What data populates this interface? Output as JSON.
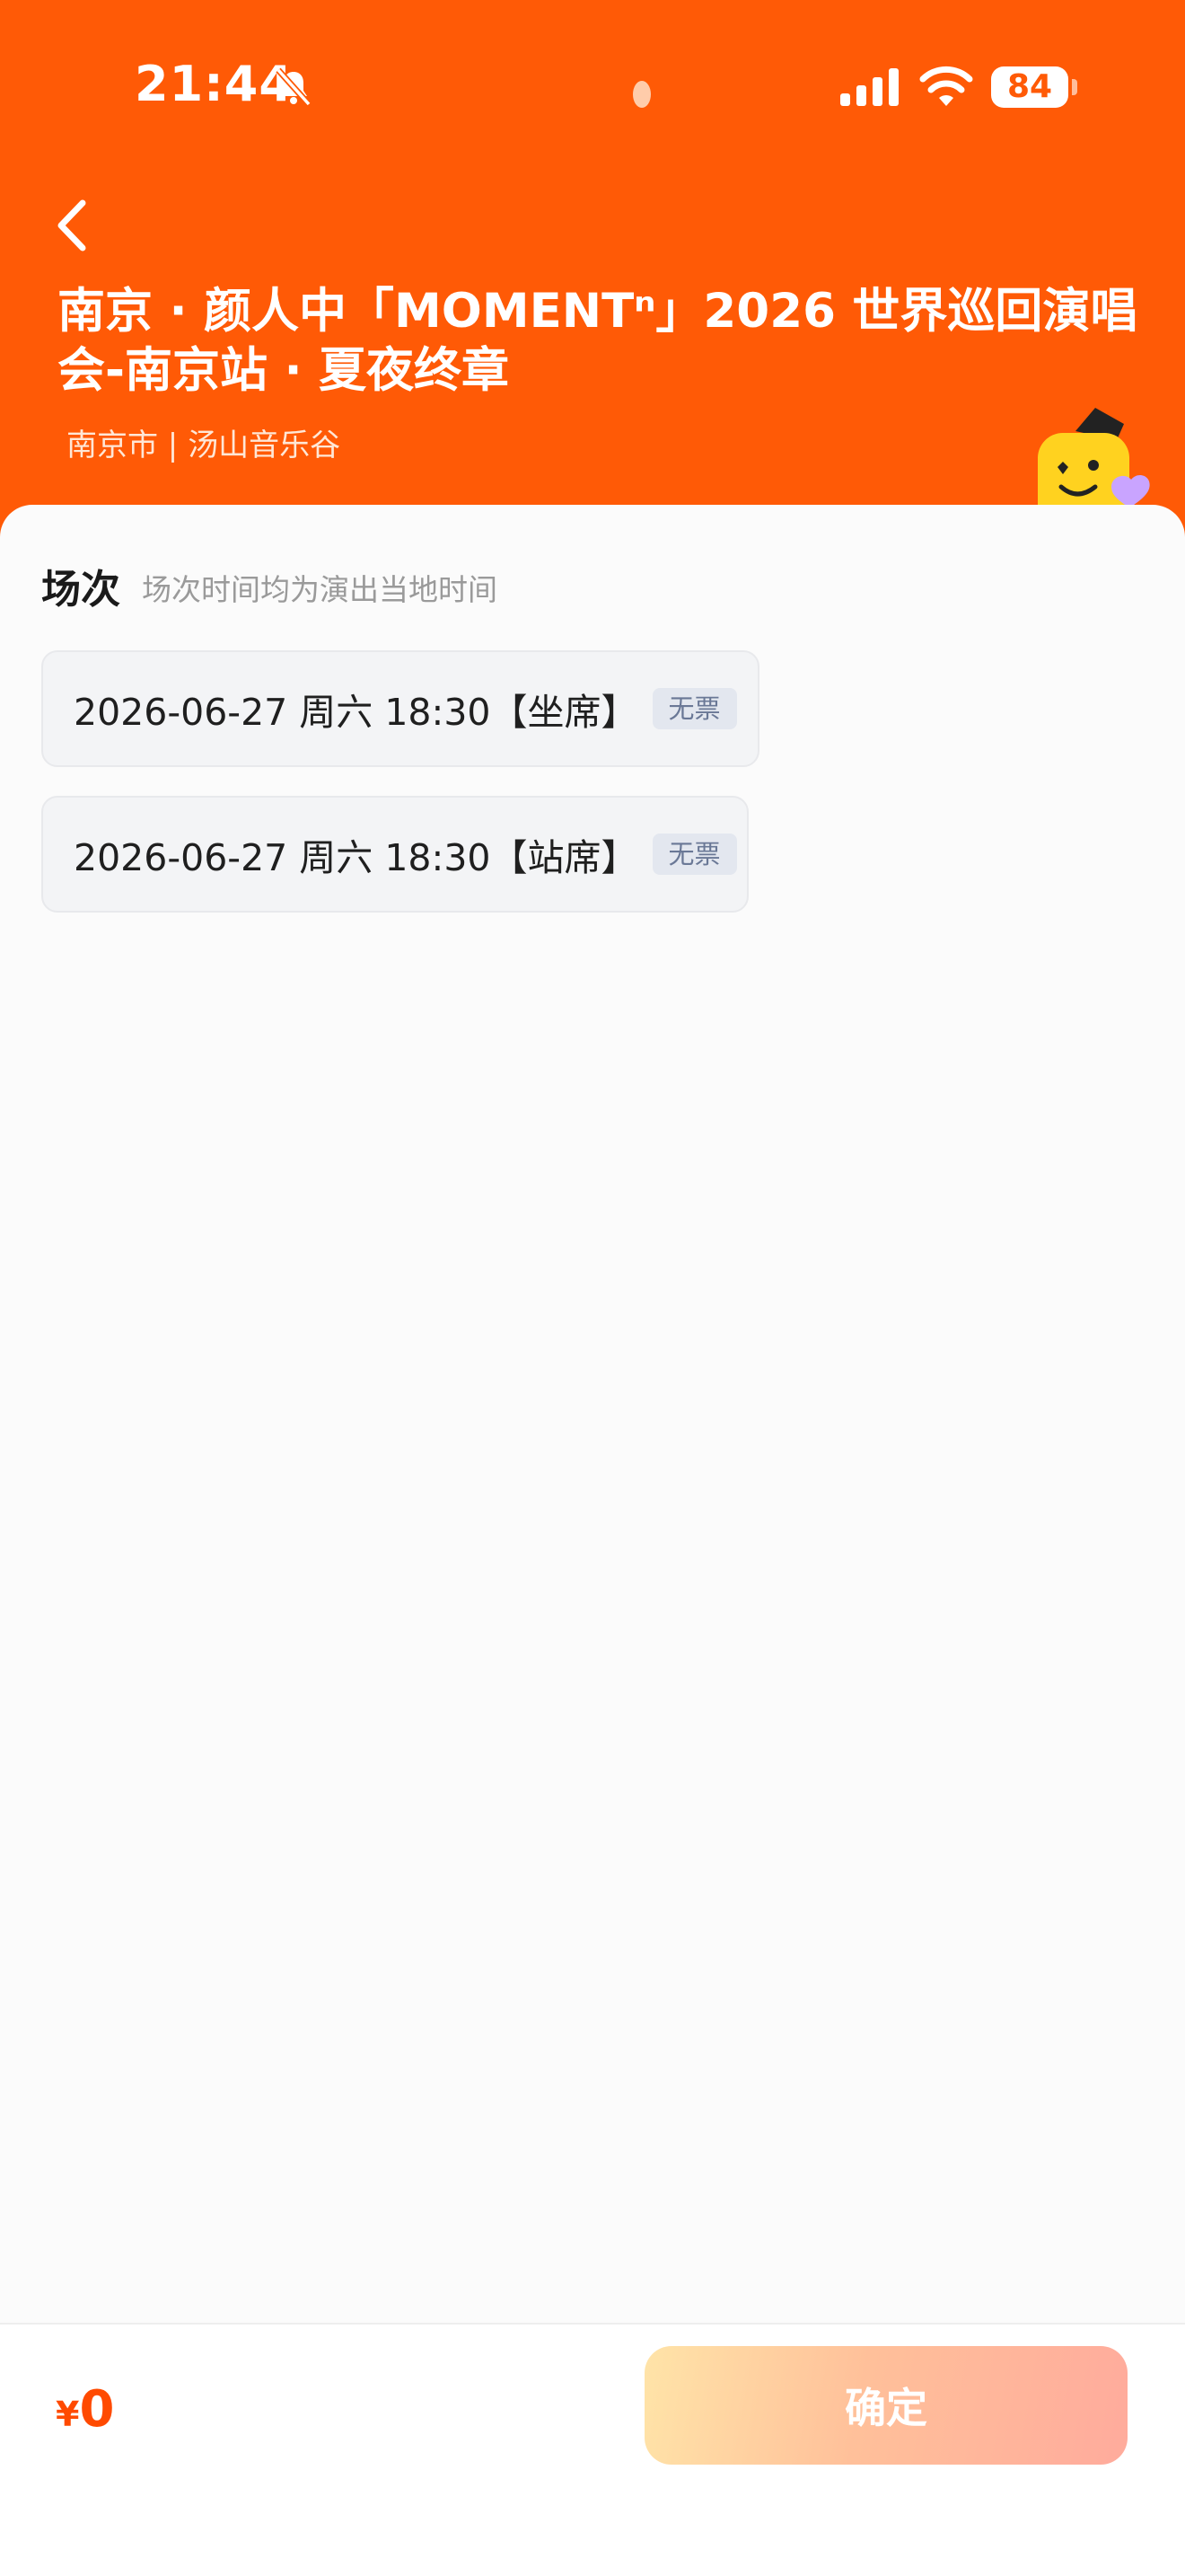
{
  "status_bar": {
    "time": "21:44",
    "battery": "84"
  },
  "header": {
    "title": "南京 · 颜人中「MOMENTⁿ」2026 世界巡回演唱会-南京站 · 夏夜终章",
    "location": "南京市 | 汤山音乐谷"
  },
  "sessions": {
    "title": "场次",
    "hint": "场次时间均为演出当地时间",
    "items": [
      {
        "label": "2026-06-27  周六 18:30【坐席】",
        "badge": "无票"
      },
      {
        "label": "2026-06-27 周六 18:30【站席】",
        "badge": "无票"
      }
    ]
  },
  "footer": {
    "currency": "¥",
    "price": "0",
    "confirm_label": "确定"
  },
  "colors": {
    "header_bg": "#ff5a06",
    "price": "#ff4a00",
    "badge_text": "#6a7896"
  }
}
